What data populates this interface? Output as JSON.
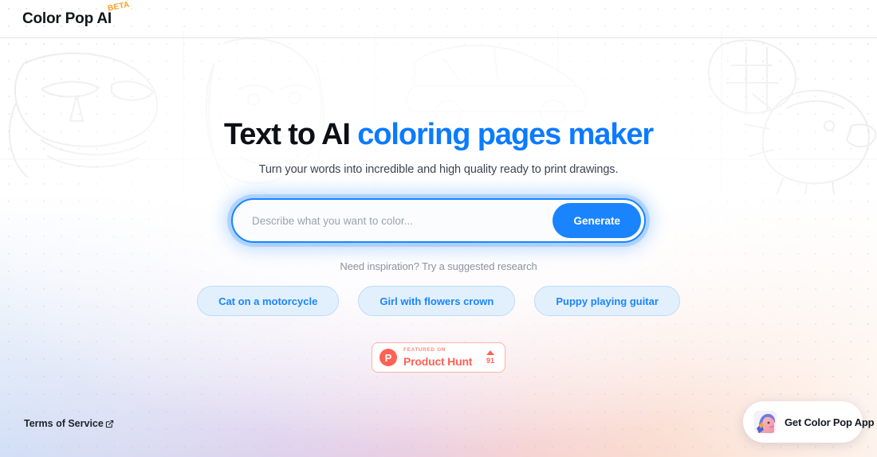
{
  "header": {
    "logo_text": "Color Pop AI",
    "beta_badge": "BETA"
  },
  "hero": {
    "headline_plain": "Text to AI ",
    "headline_accent": "coloring pages maker",
    "subtitle": "Turn your words into incredible and high quality ready to print drawings.",
    "inspiration_label": "Need inspiration? Try a suggested research"
  },
  "search": {
    "placeholder": "Describe what you want to color...",
    "value": "",
    "generate_label": "Generate"
  },
  "chips": [
    {
      "label": "Cat on a motorcycle"
    },
    {
      "label": "Girl with flowers crown"
    },
    {
      "label": "Puppy playing guitar"
    }
  ],
  "product_hunt": {
    "logo_letter": "P",
    "featured_label": "FEATURED ON",
    "name": "Product Hunt",
    "upvotes": "91"
  },
  "footer": {
    "terms_label": "Terms of Service",
    "external_link_icon": "external-link-icon"
  },
  "app_cta": {
    "label": "Get Color Pop App",
    "icon": "color-pop-app-icon"
  },
  "colors": {
    "accent_blue": "#0b7bff",
    "button_blue": "#1a84ff",
    "chip_fill": "#e2f0fd",
    "chip_border": "#bcdcfa",
    "beta_orange": "#ff9e1b",
    "product_hunt_red": "#ff6154",
    "heading_dark": "#0c0f14"
  }
}
